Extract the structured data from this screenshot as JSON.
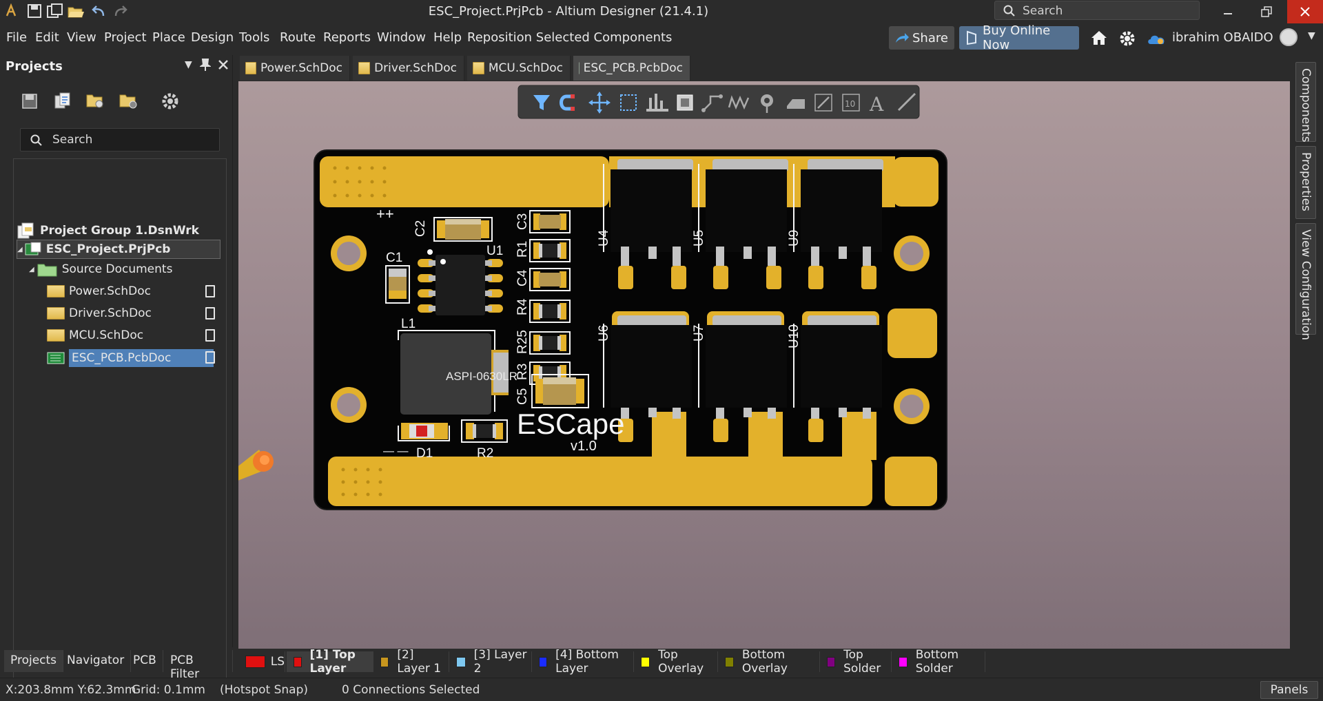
{
  "titlebar": {
    "title": "ESC_Project.PrjPcb - Altium Designer (21.4.1)",
    "search_placeholder": "Search",
    "quick_access": [
      "app-logo-icon",
      "save-icon",
      "save-all-icon",
      "open-icon",
      "undo-icon",
      "redo-icon"
    ]
  },
  "menubar": {
    "items": [
      "File",
      "Edit",
      "View",
      "Project",
      "Place",
      "Design",
      "Tools",
      "Route",
      "Reports",
      "Window",
      "Help",
      "Reposition Selected Components"
    ],
    "share_label": "Share",
    "buy_label": "Buy Online Now",
    "user_name": "ibrahim OBAIDO"
  },
  "projects_panel": {
    "title": "Projects",
    "search_placeholder": "Search",
    "tree": {
      "group": "Project Group 1.DsnWrk",
      "project": "ESC_Project.PrjPcb",
      "folder": "Source Documents",
      "docs": [
        "Power.SchDoc",
        "Driver.SchDoc",
        "MCU.SchDoc",
        "ESC_PCB.PcbDoc"
      ]
    }
  },
  "bottom_tabs": [
    "Projects",
    "Navigator",
    "PCB",
    "PCB Filter"
  ],
  "doc_tabs": [
    "Power.SchDoc",
    "Driver.SchDoc",
    "MCU.SchDoc",
    "ESC_PCB.PcbDoc"
  ],
  "right_panels": [
    "Components",
    "Properties",
    "View Configuration"
  ],
  "pcb": {
    "designators": {
      "c2": "C2",
      "c1": "C1",
      "u1": "U1",
      "l1": "L1",
      "inductor": "ASPI-0630LR",
      "c3": "C3",
      "r1": "R1",
      "c4": "C4",
      "r4": "R4",
      "r25": "R25",
      "r3": "R3",
      "c5": "C5",
      "d1": "D1",
      "r2": "R2",
      "u4": "U4",
      "u5": "U5",
      "u9": "U9",
      "u6": "U6",
      "u7": "U7",
      "u10": "U10"
    },
    "plus_marks": "++",
    "minus_marks": "— —",
    "brand": "ESCape",
    "version": "v1.0"
  },
  "layerbar": {
    "ls": "LS",
    "layers": [
      {
        "label": "[1] Top Layer",
        "color": "#e01010"
      },
      {
        "label": "[2] Layer 1",
        "color": "#c8961e"
      },
      {
        "label": "[3] Layer 2",
        "color": "#7ec8f0"
      },
      {
        "label": "[4] Bottom Layer",
        "color": "#1a2cff"
      },
      {
        "label": "Top Overlay",
        "color": "#ffff00"
      },
      {
        "label": "Bottom Overlay",
        "color": "#808000"
      },
      {
        "label": "Top Solder",
        "color": "#800080"
      },
      {
        "label": "Bottom Solder",
        "color": "#ff00ff"
      }
    ]
  },
  "statusbar": {
    "coords": "X:203.8mm Y:62.3mm",
    "grid": "Grid: 0.1mm",
    "snap": "(Hotspot Snap)",
    "connections": "0 Connections Selected",
    "panels": "Panels"
  }
}
